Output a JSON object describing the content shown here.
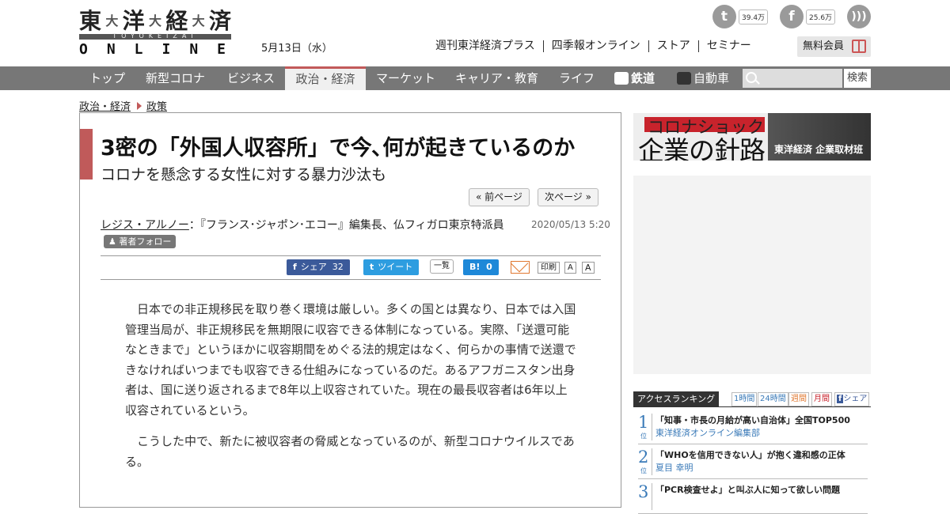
{
  "header": {
    "logo_kanji": [
      "東",
      "洋",
      "経",
      "済"
    ],
    "logo_sub": "TOYOKEIZAI",
    "logo_online": "ONLINE",
    "date": "5月13日（水）",
    "twitter_count": "39.4万",
    "facebook_count": "25.6万",
    "top_links": [
      "週刊東洋経済プラス",
      "四季報オンライン",
      "ストア",
      "セミナー"
    ],
    "member_button": "無料会員"
  },
  "global_nav": {
    "items": [
      "トップ",
      "新型コロナ",
      "ビジネス",
      "政治・経済",
      "マーケット",
      "キャリア・教育",
      "ライフ",
      "鉄道",
      "自動車"
    ],
    "active": "政治・経済",
    "search_placeholder": "",
    "search_button": "検索"
  },
  "breadcrumb": [
    "政治・経済",
    "政策"
  ],
  "article": {
    "title": "3密の「外国人収容所」で今､何が起きているのか",
    "subtitle": "コロナを懸念する女性に対する暴力沙汰も",
    "prev_page": "« 前ページ",
    "next_page": "次ページ »",
    "author_name": "レジス・アルノー",
    "author_desc": "：『フランス･ジャポン･エコー』編集長、仏フィガロ東京特派員",
    "follow_label": "著者フォロー",
    "published": "2020/05/13 5:20",
    "share": {
      "facebook_label": "シェア",
      "facebook_count": "32",
      "twitter_label": "ツイート",
      "list_label": "一覧",
      "hatena_label": "B!",
      "hatena_count": "0",
      "print_label": "印刷",
      "font_small": "A",
      "font_large": "A"
    },
    "paragraphs": [
      "日本での非正規移民を取り巻く環境は厳しい。多くの国とは異なり、日本では入国管理当局が、非正規移民を無期限に収容できる体制になっている。実際、「送還可能なときまで」というほかに収容期間をめぐる法的規定はなく、何らかの事情で送還できなければいつまでも収容できる仕組みになっているのだ。あるアフガニスタン出身者は、国に送り返されるまで8年以上収容されていた。現在の最長収容者は6年以上収容されているという。",
      "こうした中で、新たに被収容者の脅威となっているのが、新型コロナウイルスである。"
    ]
  },
  "sidebar": {
    "banner_line1": "コロナショック",
    "banner_line2": "企業の針路",
    "banner_line3": "東洋経済 企業取材班",
    "ranking_title": "アクセスランキング",
    "ranking_tabs": [
      "1時間",
      "24時間",
      "週間",
      "月間",
      "シェア"
    ],
    "ranking_items": [
      {
        "rank": "1",
        "title": "「知事・市長の月給が高い自治体」全国TOP500",
        "author": "東洋経済オンライン編集部"
      },
      {
        "rank": "2",
        "title": "「WHOを信用できない人」が抱く違和感の正体",
        "author": "夏目 幸明"
      },
      {
        "rank": "3",
        "title": "「PCR検査せよ」と叫ぶ人に知って欲しい問題",
        "author": ""
      }
    ],
    "rank_suffix": "位"
  }
}
